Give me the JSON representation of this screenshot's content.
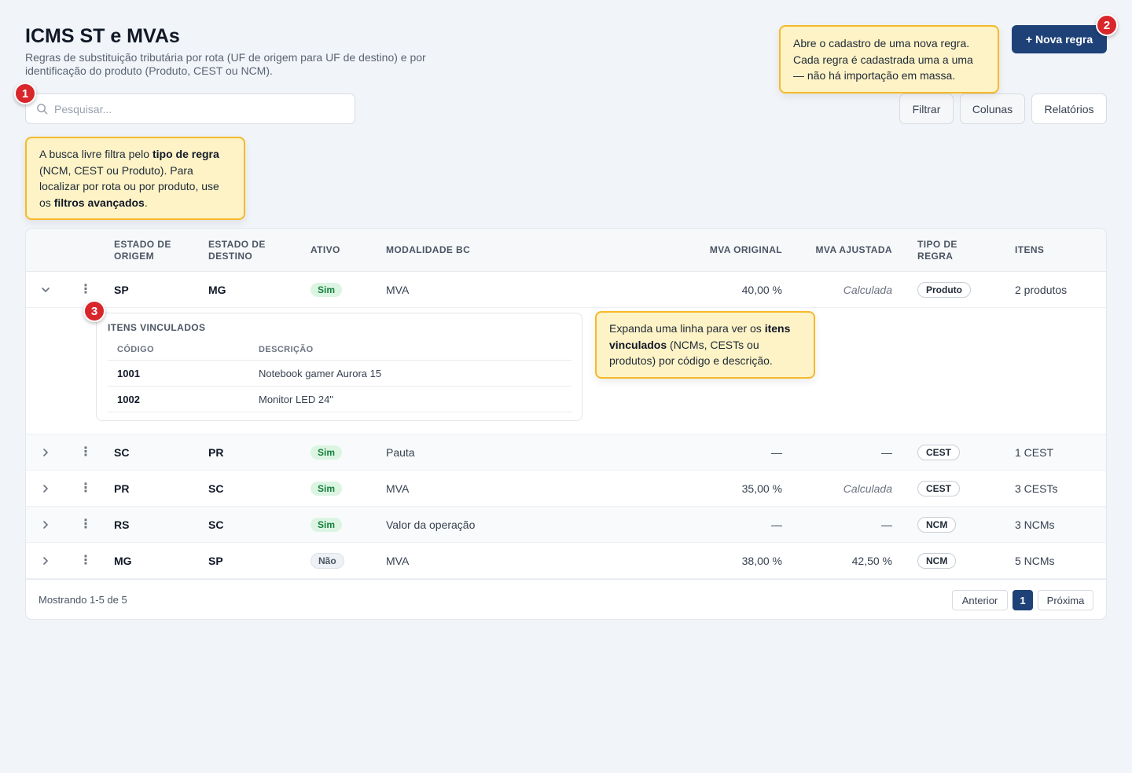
{
  "header": {
    "title": "ICMS ST e MVAs",
    "subtitle": "Regras de substituição tributária por rota (UF de origem para UF de destino) e por identificação do produto (Produto, CEST ou NCM)."
  },
  "search": {
    "placeholder": "Pesquisar..."
  },
  "toolbar": {
    "new_rule": "+ Nova regra",
    "filter": "Filtrar",
    "columns": "Colunas",
    "reports": "Relatórios"
  },
  "callouts": {
    "c1": {
      "num": "1",
      "t1": "A busca livre filtra pelo ",
      "b1": "tipo de regra",
      "t2": " (NCM, CEST ou Produto). Para localizar por rota ou por produto, use os ",
      "b2": "filtros avançados",
      "t3": "."
    },
    "c2": {
      "num": "2",
      "t1": "Abre o cadastro de uma nova regra. Cada regra é cadastrada uma a uma — não há importação em massa."
    },
    "c3": {
      "num": "3",
      "t1": "Expanda uma linha para ver os ",
      "b1": "itens vinculados",
      "t2": " (NCMs, CESTs ou produtos) por código e descrição."
    }
  },
  "table": {
    "headers": {
      "origin": "ESTADO DE ORIGEM",
      "dest": "ESTADO DE DESTINO",
      "active": "ATIVO",
      "modality": "MODALIDADE BC",
      "mva_orig": "MVA ORIGINAL",
      "mva_adj": "MVA AJUSTADA",
      "type": "TIPO DE REGRA",
      "items": "ITENS"
    },
    "rows": [
      {
        "origin": "SP",
        "dest": "MG",
        "active": "Sim",
        "modality": "MVA",
        "mva_orig": "40,00 %",
        "mva_adj": "Calculada",
        "type": "Produto",
        "items": "2 produtos"
      },
      {
        "origin": "SC",
        "dest": "PR",
        "active": "Sim",
        "modality": "Pauta",
        "mva_orig": "—",
        "mva_adj": "—",
        "type": "CEST",
        "items": "1 CEST"
      },
      {
        "origin": "PR",
        "dest": "SC",
        "active": "Sim",
        "modality": "MVA",
        "mva_orig": "35,00 %",
        "mva_adj": "Calculada",
        "type": "CEST",
        "items": "3 CESTs"
      },
      {
        "origin": "RS",
        "dest": "SC",
        "active": "Sim",
        "modality": "Valor da operação",
        "mva_orig": "—",
        "mva_adj": "—",
        "type": "NCM",
        "items": "3 NCMs"
      },
      {
        "origin": "MG",
        "dest": "SP",
        "active": "Não",
        "modality": "MVA",
        "mva_orig": "38,00 %",
        "mva_adj": "42,50 %",
        "type": "NCM",
        "items": "5 NCMs"
      }
    ],
    "linked": {
      "title": "ITENS VINCULADOS",
      "col_code": "CÓDIGO",
      "col_desc": "DESCRIÇÃO",
      "items": [
        {
          "code": "1001",
          "desc": "Notebook gamer Aurora 15"
        },
        {
          "code": "1002",
          "desc": "Monitor LED 24\""
        }
      ]
    }
  },
  "footer": {
    "showing": "Mostrando 1-5 de 5",
    "prev": "Anterior",
    "page": "1",
    "next": "Próxima"
  },
  "colors": {
    "primary": "#1e4277",
    "callout_bg": "#fdf3c6",
    "callout_border": "#f5b92a",
    "badge": "#d8262a",
    "yes_bg": "#dcf5e3"
  }
}
